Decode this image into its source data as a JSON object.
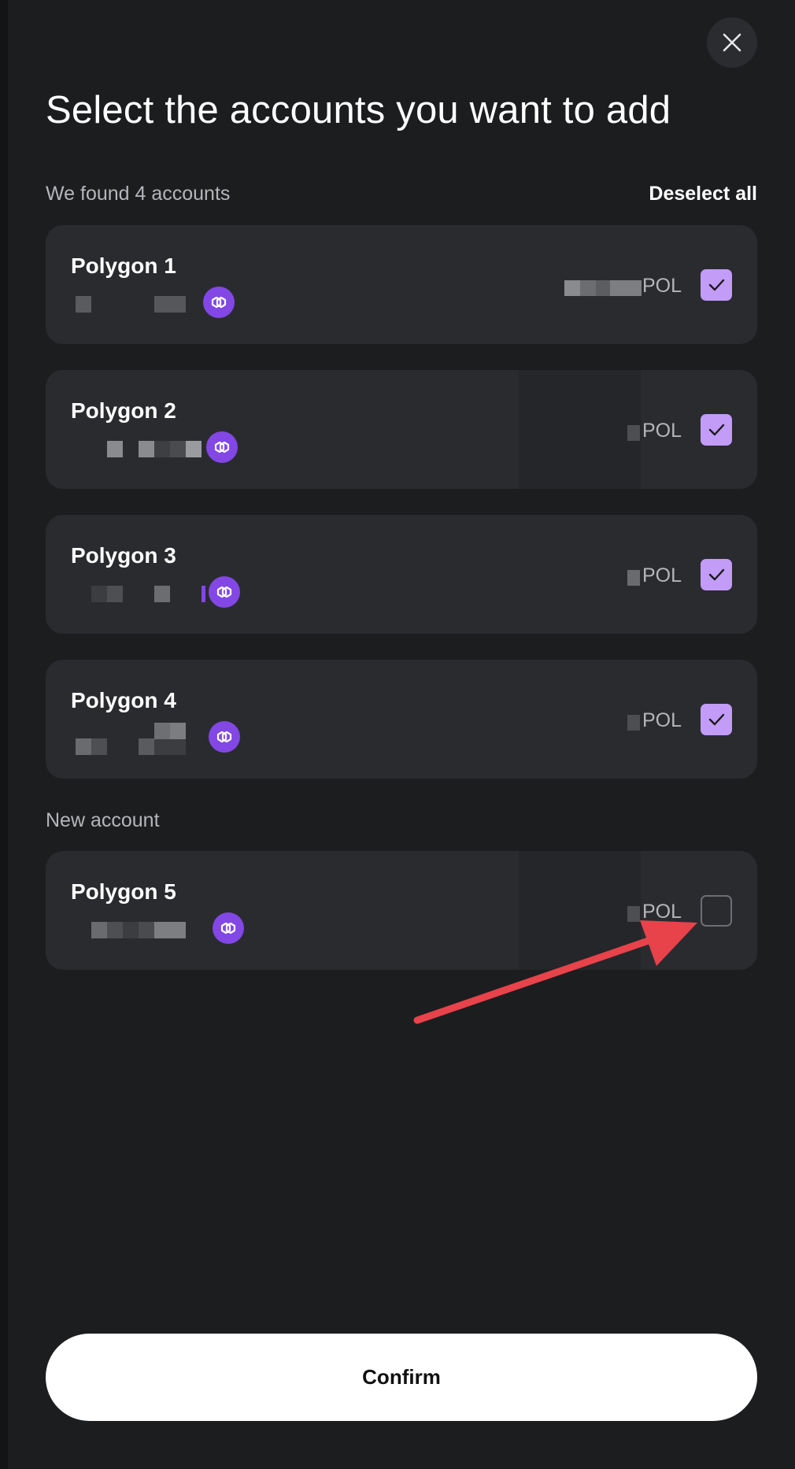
{
  "header": {
    "close_icon": "close-icon",
    "title": "Select the accounts you want to add"
  },
  "found": {
    "label": "We found 4 accounts",
    "deselect_all": "Deselect all"
  },
  "accounts": [
    {
      "name": "Polygon 1",
      "currency": "POL",
      "checked": true,
      "chain_icon": "polygon-icon"
    },
    {
      "name": "Polygon 2",
      "currency": "POL",
      "checked": true,
      "chain_icon": "polygon-icon"
    },
    {
      "name": "Polygon 3",
      "currency": "POL",
      "checked": true,
      "chain_icon": "polygon-icon"
    },
    {
      "name": "Polygon 4",
      "currency": "POL",
      "checked": true,
      "chain_icon": "polygon-icon"
    }
  ],
  "new_section": {
    "label": "New account",
    "account": {
      "name": "Polygon 5",
      "currency": "POL",
      "checked": false,
      "chain_icon": "polygon-icon"
    }
  },
  "annotation": {
    "type": "arrow",
    "color": "#e8424a",
    "points_to": "Polygon 5 checkbox"
  },
  "colors": {
    "background": "#1c1d1f",
    "card": "#2a2b2f",
    "checkbox_checked": "#c29cf7",
    "polygon_purple": "#8247e5"
  },
  "footer": {
    "confirm_label": "Confirm"
  }
}
